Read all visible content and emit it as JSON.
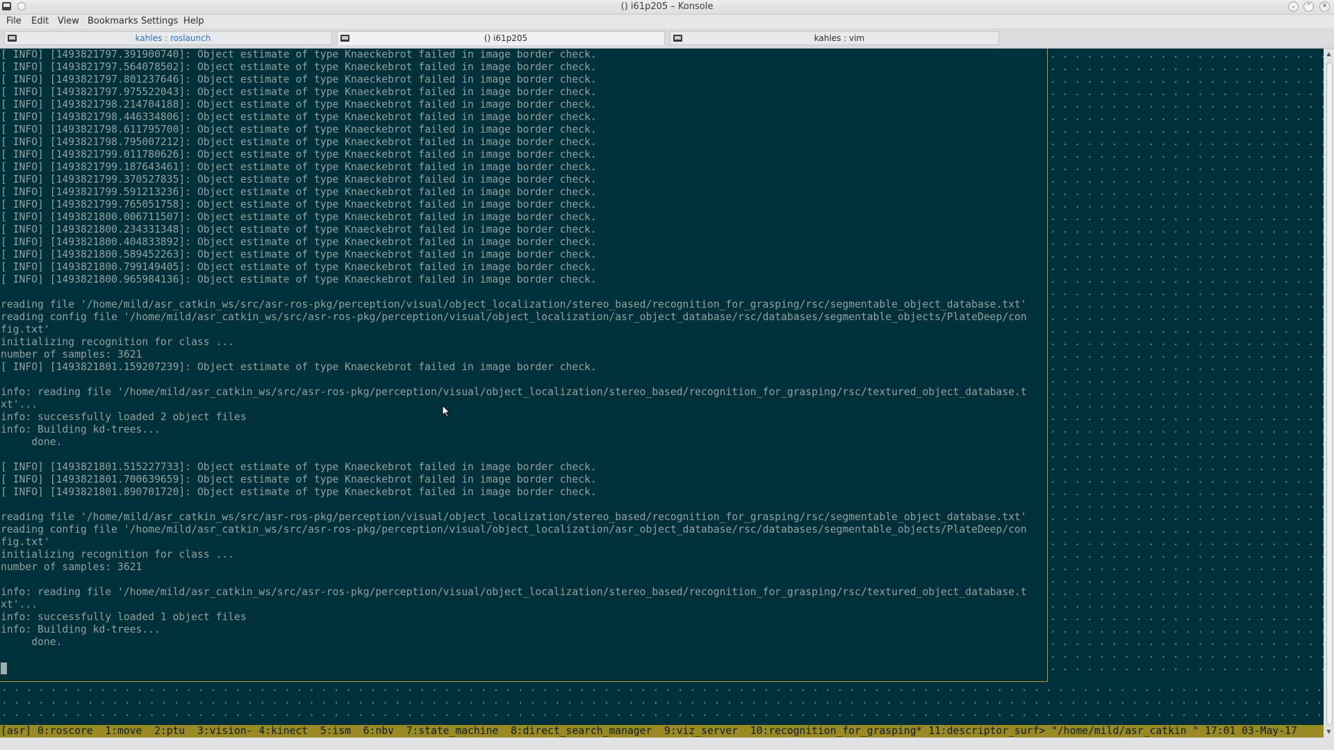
{
  "window": {
    "title": "() i61p205 – Konsole",
    "buttons": [
      "minimize-icon",
      "maximize-icon",
      "close-icon"
    ]
  },
  "menu": [
    "File",
    "Edit",
    "View",
    "Bookmarks",
    "Settings",
    "Help"
  ],
  "tabs": [
    {
      "label": "kahles : roslaunch",
      "icon": "terminal-icon"
    },
    {
      "label": "() i61p205",
      "icon": "terminal-icon"
    },
    {
      "label": "kahles : vim",
      "icon": "terminal-icon"
    }
  ],
  "terminal": {
    "lines": [
      "[ INFO] [1493821797.391900740]: Object estimate of type Knaeckebrot failed in image border check.",
      "[ INFO] [1493821797.564078502]: Object estimate of type Knaeckebrot failed in image border check.",
      "[ INFO] [1493821797.801237646]: Object estimate of type Knaeckebrot failed in image border check.",
      "[ INFO] [1493821797.975522043]: Object estimate of type Knaeckebrot failed in image border check.",
      "[ INFO] [1493821798.214704188]: Object estimate of type Knaeckebrot failed in image border check.",
      "[ INFO] [1493821798.446334806]: Object estimate of type Knaeckebrot failed in image border check.",
      "[ INFO] [1493821798.611795700]: Object estimate of type Knaeckebrot failed in image border check.",
      "[ INFO] [1493821798.795007212]: Object estimate of type Knaeckebrot failed in image border check.",
      "[ INFO] [1493821799.011780626]: Object estimate of type Knaeckebrot failed in image border check.",
      "[ INFO] [1493821799.187643461]: Object estimate of type Knaeckebrot failed in image border check.",
      "[ INFO] [1493821799.370527835]: Object estimate of type Knaeckebrot failed in image border check.",
      "[ INFO] [1493821799.591213236]: Object estimate of type Knaeckebrot failed in image border check.",
      "[ INFO] [1493821799.765051758]: Object estimate of type Knaeckebrot failed in image border check.",
      "[ INFO] [1493821800.006711507]: Object estimate of type Knaeckebrot failed in image border check.",
      "[ INFO] [1493821800.234331348]: Object estimate of type Knaeckebrot failed in image border check.",
      "[ INFO] [1493821800.404833892]: Object estimate of type Knaeckebrot failed in image border check.",
      "[ INFO] [1493821800.589452263]: Object estimate of type Knaeckebrot failed in image border check.",
      "[ INFO] [1493821800.799149405]: Object estimate of type Knaeckebrot failed in image border check.",
      "[ INFO] [1493821800.965984136]: Object estimate of type Knaeckebrot failed in image border check.",
      "",
      "reading file '/home/mild/asr_catkin_ws/src/asr-ros-pkg/perception/visual/object_localization/stereo_based/recognition_for_grasping/rsc/segmentable_object_database.txt'",
      "reading config file '/home/mild/asr_catkin_ws/src/asr-ros-pkg/perception/visual/object_localization/asr_object_database/rsc/databases/segmentable_objects/PlateDeep/con",
      "fig.txt'",
      "initializing recognition for class ...",
      "number of samples: 3621",
      "[ INFO] [1493821801.159207239]: Object estimate of type Knaeckebrot failed in image border check.",
      "",
      "info: reading file '/home/mild/asr_catkin_ws/src/asr-ros-pkg/perception/visual/object_localization/stereo_based/recognition_for_grasping/rsc/textured_object_database.t",
      "xt'...",
      "info: successfully loaded 2 object files",
      "info: Building kd-trees...",
      "     done.",
      "",
      "[ INFO] [1493821801.515227733]: Object estimate of type Knaeckebrot failed in image border check.",
      "[ INFO] [1493821801.700639659]: Object estimate of type Knaeckebrot failed in image border check.",
      "[ INFO] [1493821801.890701720]: Object estimate of type Knaeckebrot failed in image border check.",
      "",
      "reading file '/home/mild/asr_catkin_ws/src/asr-ros-pkg/perception/visual/object_localization/stereo_based/recognition_for_grasping/rsc/segmentable_object_database.txt'",
      "reading config file '/home/mild/asr_catkin_ws/src/asr-ros-pkg/perception/visual/object_localization/asr_object_database/rsc/databases/segmentable_objects/PlateDeep/con",
      "fig.txt'",
      "initializing recognition for class ...",
      "number of samples: 3621",
      "",
      "info: reading file '/home/mild/asr_catkin_ws/src/asr-ros-pkg/perception/visual/object_localization/stereo_based/recognition_for_grasping/rsc/textured_object_database.t",
      "xt'...",
      "info: successfully loaded 1 object files",
      "info: Building kd-trees...",
      "     done."
    ],
    "status_line": "[asr] 0:roscore  1:move  2:ptu  3:vision- 4:kinect  5:ism  6:nbv  7:state_machine  8:direct_search_manager  9:viz_server  10:recognition_for_grasping* 11:descriptor_surf> \"/home/mild/asr_catkin \" 17:01 03-May-17",
    "colors": {
      "background": "#00313b",
      "foreground": "#93a1a1",
      "status_bar": "#9a8a24",
      "pane_border": "#b59f3e"
    }
  }
}
